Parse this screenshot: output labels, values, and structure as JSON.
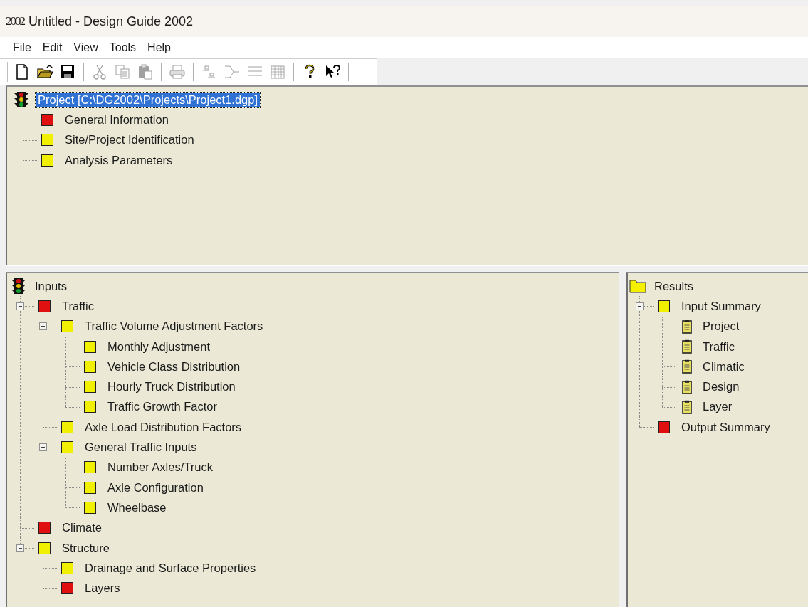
{
  "window": {
    "icon_text": "2002",
    "title": "Untitled - Design Guide 2002"
  },
  "menu": [
    "File",
    "Edit",
    "View",
    "Tools",
    "Help"
  ],
  "toolbar": [
    [
      {
        "kind": "new",
        "disabled": false
      },
      {
        "kind": "open",
        "disabled": false
      },
      {
        "kind": "save",
        "disabled": false
      }
    ],
    [
      {
        "kind": "cut",
        "disabled": true
      },
      {
        "kind": "copy",
        "disabled": true
      },
      {
        "kind": "paste",
        "disabled": true
      }
    ],
    [
      {
        "kind": "print",
        "disabled": true
      }
    ],
    [
      {
        "kind": "node-pair",
        "disabled": true
      },
      {
        "kind": "node-branch",
        "disabled": true
      },
      {
        "kind": "node-grid",
        "disabled": true
      },
      {
        "kind": "table",
        "disabled": true
      }
    ],
    [
      {
        "kind": "help",
        "disabled": false
      },
      {
        "kind": "context-help",
        "disabled": false
      }
    ]
  ],
  "project_tree": {
    "label": "Project [C:\\DG2002\\Projects\\Project1.dgp]",
    "kind": "traffic-light",
    "selected": true,
    "children": [
      {
        "label": "General Information",
        "kind": "status",
        "color": "#e01010",
        "selected": false
      },
      {
        "label": "Site/Project Identification",
        "kind": "status",
        "color": "#f0f000",
        "selected": false
      },
      {
        "label": "Analysis Parameters",
        "kind": "status",
        "color": "#f0f000",
        "selected": false
      }
    ]
  },
  "inputs_tree": {
    "label": "Inputs",
    "kind": "traffic-light",
    "selected": false,
    "children": [
      {
        "label": "Traffic",
        "kind": "status",
        "color": "#e01010",
        "selected": false,
        "expanded": true,
        "children": [
          {
            "label": "Traffic Volume Adjustment Factors",
            "kind": "status",
            "color": "#f0f000",
            "selected": false,
            "expanded": true,
            "children": [
              {
                "label": "Monthly Adjustment",
                "kind": "status",
                "color": "#f0f000",
                "selected": false
              },
              {
                "label": "Vehicle Class Distribution",
                "kind": "status",
                "color": "#f0f000",
                "selected": false
              },
              {
                "label": "Hourly Truck Distribution",
                "kind": "status",
                "color": "#f0f000",
                "selected": false
              },
              {
                "label": "Traffic Growth Factor",
                "kind": "status",
                "color": "#f0f000",
                "selected": false
              }
            ]
          },
          {
            "label": "Axle Load Distribution Factors",
            "kind": "status",
            "color": "#f0f000",
            "selected": false
          },
          {
            "label": "General Traffic Inputs",
            "kind": "status",
            "color": "#f0f000",
            "selected": false,
            "expanded": true,
            "children": [
              {
                "label": "Number Axles/Truck",
                "kind": "status",
                "color": "#f0f000",
                "selected": false
              },
              {
                "label": "Axle Configuration",
                "kind": "status",
                "color": "#f0f000",
                "selected": false
              },
              {
                "label": "Wheelbase",
                "kind": "status",
                "color": "#f0f000",
                "selected": false
              }
            ]
          }
        ]
      },
      {
        "label": "Climate",
        "kind": "status",
        "color": "#e01010",
        "selected": false
      },
      {
        "label": "Structure",
        "kind": "status",
        "color": "#f0f000",
        "selected": false,
        "expanded": true,
        "children": [
          {
            "label": "Drainage and Surface Properties",
            "kind": "status",
            "color": "#f0f000",
            "selected": false
          },
          {
            "label": "Layers",
            "kind": "status",
            "color": "#e01010",
            "selected": false
          }
        ]
      }
    ]
  },
  "results_tree": {
    "label": "Results",
    "kind": "folder",
    "selected": false,
    "children": [
      {
        "label": "Input Summary",
        "kind": "status",
        "color": "#f0f000",
        "selected": false,
        "expanded": true,
        "children": [
          {
            "label": "Project",
            "kind": "clipboard",
            "selected": false
          },
          {
            "label": "Traffic",
            "kind": "clipboard",
            "selected": false
          },
          {
            "label": "Climatic",
            "kind": "clipboard",
            "selected": false
          },
          {
            "label": "Design",
            "kind": "clipboard",
            "selected": false
          },
          {
            "label": "Layer",
            "kind": "clipboard",
            "selected": false
          }
        ]
      },
      {
        "label": "Output Summary",
        "kind": "status",
        "color": "#e01010",
        "selected": false
      }
    ]
  }
}
